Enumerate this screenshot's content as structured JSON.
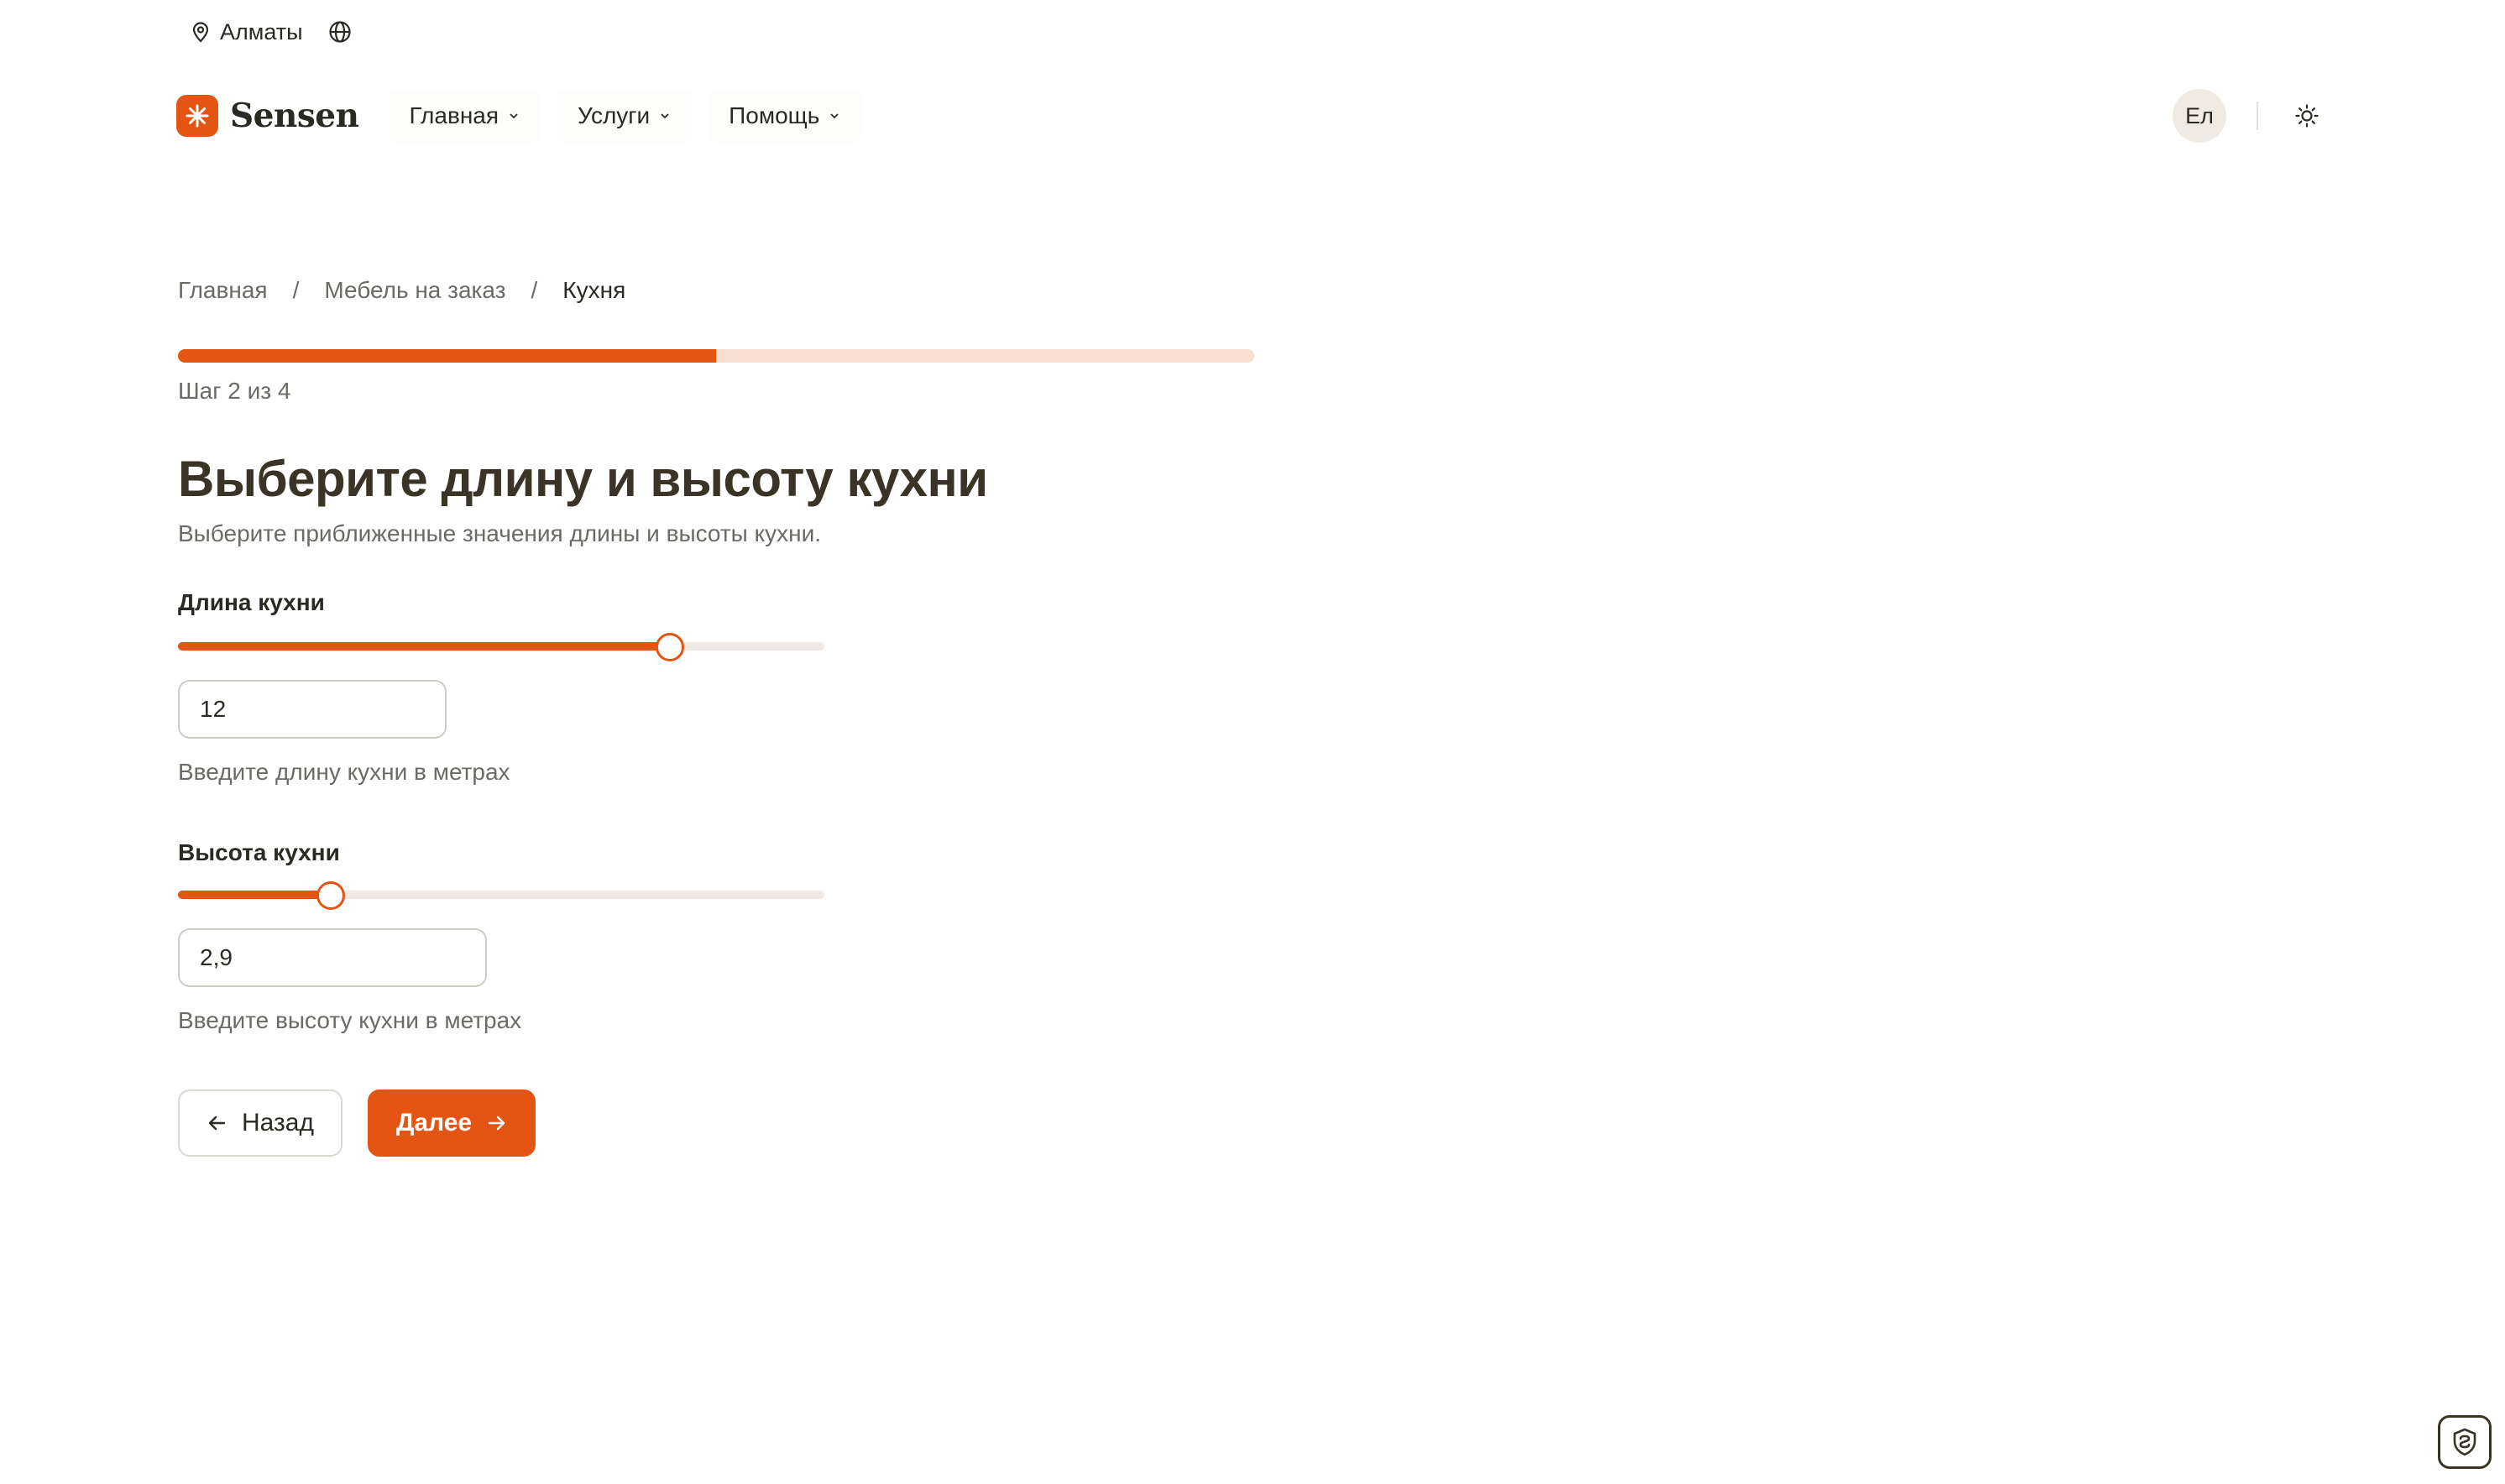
{
  "topbar": {
    "city": "Алматы",
    "location_icon": "map-pin-icon",
    "language_icon": "globe-icon"
  },
  "header": {
    "logo_text": "Sensen",
    "menu": [
      {
        "label": "Главная"
      },
      {
        "label": "Услуги"
      },
      {
        "label": "Помощь"
      }
    ],
    "avatar_initials": "Ел",
    "theme_icon": "sun-icon"
  },
  "breadcrumb": {
    "items": [
      "Главная",
      "Мебель на заказ",
      "Кухня"
    ],
    "separator": "/"
  },
  "progress": {
    "label": "Шаг 2 из 4",
    "current_step": 2,
    "total_steps": 4,
    "fraction": 0.5
  },
  "form": {
    "title": "Выберите длину и высоту кухни",
    "subtitle": "Выберите приближенные значения длины и высоты кухни.",
    "length": {
      "label": "Длина кухни",
      "value": "12",
      "slider_fraction": 0.76,
      "helper": "Введите длину кухни в метрах"
    },
    "height": {
      "label": "Высота кухни",
      "value": "2,9",
      "slider_fraction": 0.235,
      "helper": "Введите высоту кухни в метрах"
    }
  },
  "actions": {
    "back_label": "Назад",
    "next_label": "Далее"
  },
  "colors": {
    "accent": "#e45514",
    "accent_light": "#f7ddd2",
    "text": "#2b2a22",
    "muted": "#6b6a64",
    "avatar_bg": "#efebe2"
  }
}
